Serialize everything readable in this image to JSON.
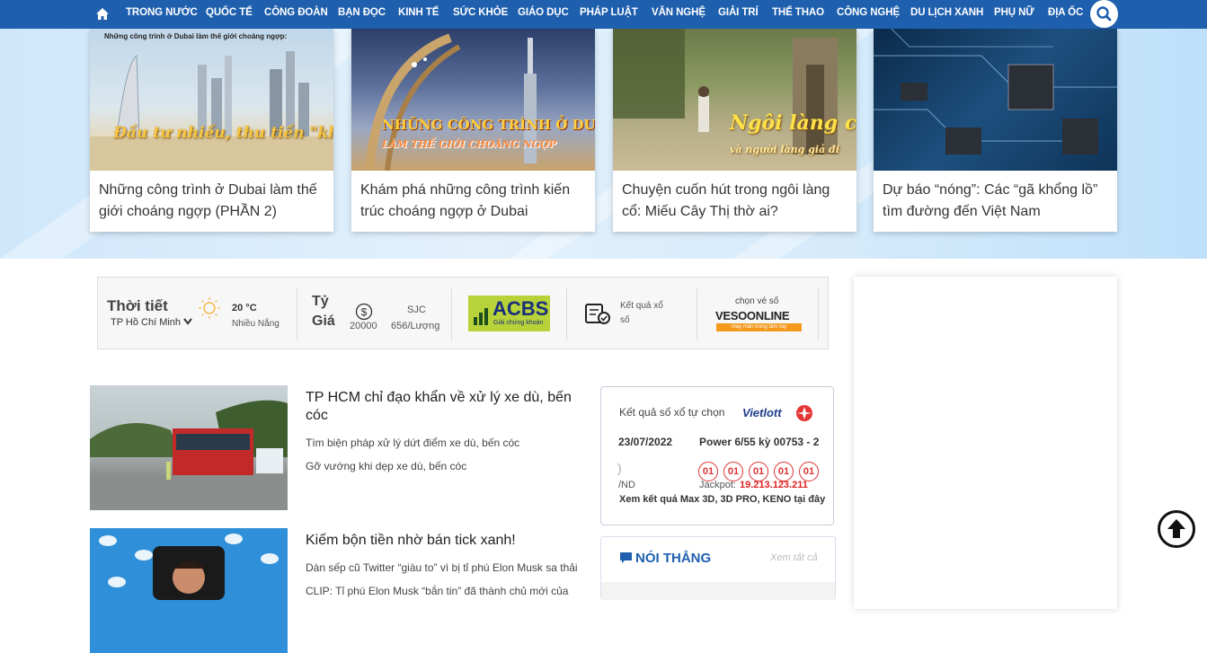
{
  "nav": {
    "items": [
      "TRONG NƯỚC",
      "QUỐC TẾ",
      "CÔNG ĐOÀN",
      "BẠN ĐỌC",
      "KINH TẾ",
      "SỨC KHỎE",
      "GIÁO DỤC",
      "PHÁP LUẬT",
      "VĂN NGHỆ",
      "GIẢI TRÍ",
      "THỂ THAO",
      "CÔNG NGHỆ",
      "DU LỊCH XANH",
      "PHỤ NỮ",
      "ĐỊA ỐC"
    ],
    "home_icon": "home-icon",
    "search_icon": "search-icon",
    "color": "#1e5fae"
  },
  "hero": {
    "cards": [
      {
        "title": "Những công trình ở Dubai làm thế giới choáng ngợp (PHẦN 2)",
        "img_header": "Những công trình ở Dubai làm thế giới choáng ngợp:",
        "img_text": "Đầu tư nhiều, thu tiền \"khủng\""
      },
      {
        "title": "Khám phá những công trình kiến trúc choáng ngợp ở Dubai",
        "img_text": "NHỮNG CÔNG TRÌNH Ở DUBAI",
        "img_text2": "LÀM THẾ GIỚI CHOÁNG NGỢP"
      },
      {
        "title": "Chuyện cuốn hút trong ngôi làng cổ: Miếu Cây Thị thờ ai?",
        "img_text": "Ngôi làng cổ",
        "img_text2": "và người làng giả đi"
      },
      {
        "title": "Dự báo “nóng”: Các “gã khổng lồ” tìm đường đến Việt Nam"
      }
    ]
  },
  "utility": {
    "weather_label": "Thời tiết",
    "location": "TP Hồ Chí Minh",
    "temp": "20 °C",
    "condition": "Nhiều Nắng",
    "rate_label": "Tỷ Giá",
    "rate_value": "20000",
    "sjc_label": "SJC",
    "sjc_value": "656/Lượng",
    "acbs_logo": "ACBS",
    "acbs_tag": "Giải chứng khoán",
    "lottery_link": "Kết quả xổ số",
    "vietlott_pre": "chọn vé số",
    "vesoonline": "VESOONLINE",
    "vesoonline_tag": "may mắn trong tầm tay"
  },
  "articles": [
    {
      "title": "TP HCM chỉ đạo khẩn về xử lý xe dù, bến cóc",
      "related": [
        "Tìm biện pháp xử lý dứt điểm xe dù, bến cóc",
        "Gỡ vướng khi dẹp xe dù, bến cóc"
      ]
    },
    {
      "title": "Kiếm bộn tiền nhờ bán tick xanh!",
      "related": [
        "Dàn sếp cũ Twitter “giàu to” vì bị tỉ phú Elon Musk sa thải",
        "CLIP: Tỉ phú Elon Musk “bắn tin” đã thành chủ mới của"
      ]
    }
  ],
  "lottery": {
    "title": "Kết quả số xổ tự chọn",
    "brand": "Vietlott",
    "date": "23/07/2022",
    "game": "Power 6/55 kỳ 00753 - 2",
    "balls": [
      "01",
      "01",
      "01",
      "01",
      "01"
    ],
    "vnd": "/ND",
    "jackpot_label": "Jackpot:",
    "jackpot_value": "19.213.123.211",
    "more": "Xem kết quả Max 3D, 3D PRO, KENO tại đây"
  },
  "noi_thang": {
    "title": "NÓI THẲNG",
    "see_all": "Xem tất cả"
  }
}
